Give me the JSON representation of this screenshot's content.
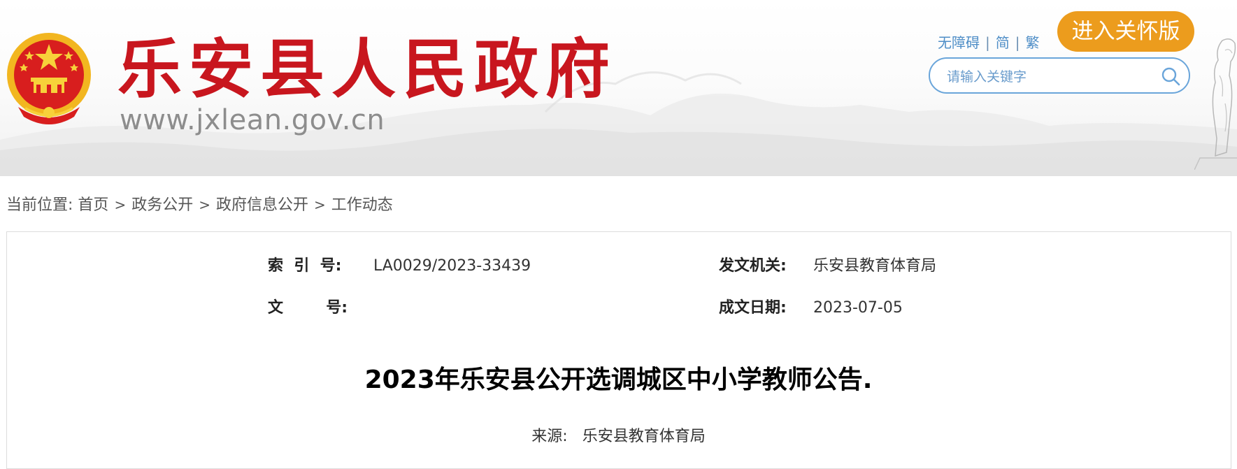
{
  "header": {
    "site_title": "乐安县人民政府",
    "site_url": "www.jxlean.gov.cn",
    "links": {
      "accessibility": "无障碍",
      "simplified": "简",
      "traditional": "繁",
      "separator": "|"
    },
    "care_button": "进入关怀版",
    "search": {
      "placeholder": "请输入关键字"
    }
  },
  "breadcrumb": {
    "label": "当前位置:",
    "items": [
      "首页",
      "政务公开",
      "政府信息公开",
      "工作动态"
    ],
    "arrow": ">"
  },
  "meta": {
    "index_label": "索  引  号:",
    "index_value": "LA0029/2023-33439",
    "doc_no_label": "文        号:",
    "doc_no_value": "",
    "issuer_label": "发文机关:",
    "issuer_value": "乐安县教育体育局",
    "date_label": "成文日期:",
    "date_value": "2023-07-05"
  },
  "article": {
    "title": "2023年乐安县公开选调城区中小学教师公告.",
    "source_label": "来源:",
    "source_value": "乐安县教育体育局"
  },
  "colors": {
    "brand_red": "#c8161e",
    "care_orange": "#ec9c1d",
    "link_blue": "#4f8ec7",
    "search_border": "#6aa5da"
  },
  "icons": [
    "national-emblem-icon",
    "search-icon"
  ]
}
